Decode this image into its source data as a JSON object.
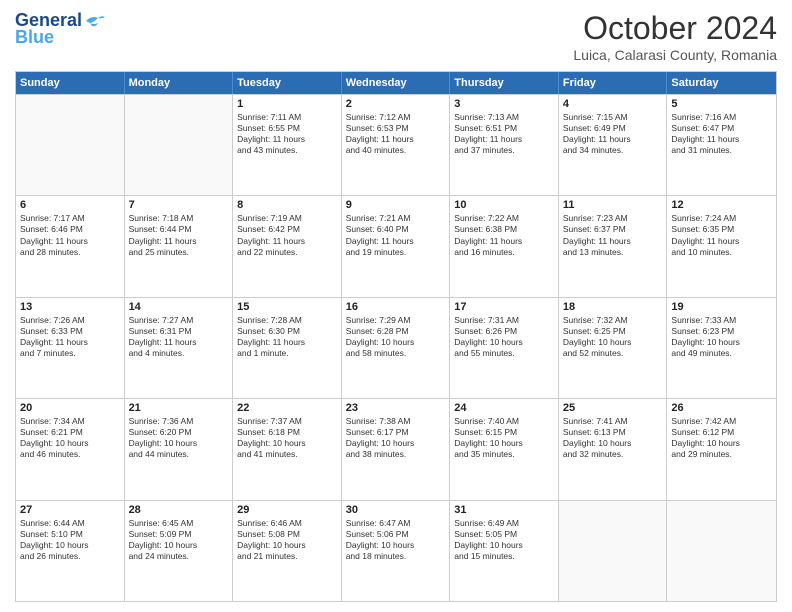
{
  "header": {
    "logo_general": "General",
    "logo_blue": "Blue",
    "month_title": "October 2024",
    "subtitle": "Luica, Calarasi County, Romania"
  },
  "calendar": {
    "days_of_week": [
      "Sunday",
      "Monday",
      "Tuesday",
      "Wednesday",
      "Thursday",
      "Friday",
      "Saturday"
    ],
    "weeks": [
      [
        {
          "day": "",
          "lines": []
        },
        {
          "day": "",
          "lines": []
        },
        {
          "day": "1",
          "lines": [
            "Sunrise: 7:11 AM",
            "Sunset: 6:55 PM",
            "Daylight: 11 hours",
            "and 43 minutes."
          ]
        },
        {
          "day": "2",
          "lines": [
            "Sunrise: 7:12 AM",
            "Sunset: 6:53 PM",
            "Daylight: 11 hours",
            "and 40 minutes."
          ]
        },
        {
          "day": "3",
          "lines": [
            "Sunrise: 7:13 AM",
            "Sunset: 6:51 PM",
            "Daylight: 11 hours",
            "and 37 minutes."
          ]
        },
        {
          "day": "4",
          "lines": [
            "Sunrise: 7:15 AM",
            "Sunset: 6:49 PM",
            "Daylight: 11 hours",
            "and 34 minutes."
          ]
        },
        {
          "day": "5",
          "lines": [
            "Sunrise: 7:16 AM",
            "Sunset: 6:47 PM",
            "Daylight: 11 hours",
            "and 31 minutes."
          ]
        }
      ],
      [
        {
          "day": "6",
          "lines": [
            "Sunrise: 7:17 AM",
            "Sunset: 6:46 PM",
            "Daylight: 11 hours",
            "and 28 minutes."
          ]
        },
        {
          "day": "7",
          "lines": [
            "Sunrise: 7:18 AM",
            "Sunset: 6:44 PM",
            "Daylight: 11 hours",
            "and 25 minutes."
          ]
        },
        {
          "day": "8",
          "lines": [
            "Sunrise: 7:19 AM",
            "Sunset: 6:42 PM",
            "Daylight: 11 hours",
            "and 22 minutes."
          ]
        },
        {
          "day": "9",
          "lines": [
            "Sunrise: 7:21 AM",
            "Sunset: 6:40 PM",
            "Daylight: 11 hours",
            "and 19 minutes."
          ]
        },
        {
          "day": "10",
          "lines": [
            "Sunrise: 7:22 AM",
            "Sunset: 6:38 PM",
            "Daylight: 11 hours",
            "and 16 minutes."
          ]
        },
        {
          "day": "11",
          "lines": [
            "Sunrise: 7:23 AM",
            "Sunset: 6:37 PM",
            "Daylight: 11 hours",
            "and 13 minutes."
          ]
        },
        {
          "day": "12",
          "lines": [
            "Sunrise: 7:24 AM",
            "Sunset: 6:35 PM",
            "Daylight: 11 hours",
            "and 10 minutes."
          ]
        }
      ],
      [
        {
          "day": "13",
          "lines": [
            "Sunrise: 7:26 AM",
            "Sunset: 6:33 PM",
            "Daylight: 11 hours",
            "and 7 minutes."
          ]
        },
        {
          "day": "14",
          "lines": [
            "Sunrise: 7:27 AM",
            "Sunset: 6:31 PM",
            "Daylight: 11 hours",
            "and 4 minutes."
          ]
        },
        {
          "day": "15",
          "lines": [
            "Sunrise: 7:28 AM",
            "Sunset: 6:30 PM",
            "Daylight: 11 hours",
            "and 1 minute."
          ]
        },
        {
          "day": "16",
          "lines": [
            "Sunrise: 7:29 AM",
            "Sunset: 6:28 PM",
            "Daylight: 10 hours",
            "and 58 minutes."
          ]
        },
        {
          "day": "17",
          "lines": [
            "Sunrise: 7:31 AM",
            "Sunset: 6:26 PM",
            "Daylight: 10 hours",
            "and 55 minutes."
          ]
        },
        {
          "day": "18",
          "lines": [
            "Sunrise: 7:32 AM",
            "Sunset: 6:25 PM",
            "Daylight: 10 hours",
            "and 52 minutes."
          ]
        },
        {
          "day": "19",
          "lines": [
            "Sunrise: 7:33 AM",
            "Sunset: 6:23 PM",
            "Daylight: 10 hours",
            "and 49 minutes."
          ]
        }
      ],
      [
        {
          "day": "20",
          "lines": [
            "Sunrise: 7:34 AM",
            "Sunset: 6:21 PM",
            "Daylight: 10 hours",
            "and 46 minutes."
          ]
        },
        {
          "day": "21",
          "lines": [
            "Sunrise: 7:36 AM",
            "Sunset: 6:20 PM",
            "Daylight: 10 hours",
            "and 44 minutes."
          ]
        },
        {
          "day": "22",
          "lines": [
            "Sunrise: 7:37 AM",
            "Sunset: 6:18 PM",
            "Daylight: 10 hours",
            "and 41 minutes."
          ]
        },
        {
          "day": "23",
          "lines": [
            "Sunrise: 7:38 AM",
            "Sunset: 6:17 PM",
            "Daylight: 10 hours",
            "and 38 minutes."
          ]
        },
        {
          "day": "24",
          "lines": [
            "Sunrise: 7:40 AM",
            "Sunset: 6:15 PM",
            "Daylight: 10 hours",
            "and 35 minutes."
          ]
        },
        {
          "day": "25",
          "lines": [
            "Sunrise: 7:41 AM",
            "Sunset: 6:13 PM",
            "Daylight: 10 hours",
            "and 32 minutes."
          ]
        },
        {
          "day": "26",
          "lines": [
            "Sunrise: 7:42 AM",
            "Sunset: 6:12 PM",
            "Daylight: 10 hours",
            "and 29 minutes."
          ]
        }
      ],
      [
        {
          "day": "27",
          "lines": [
            "Sunrise: 6:44 AM",
            "Sunset: 5:10 PM",
            "Daylight: 10 hours",
            "and 26 minutes."
          ]
        },
        {
          "day": "28",
          "lines": [
            "Sunrise: 6:45 AM",
            "Sunset: 5:09 PM",
            "Daylight: 10 hours",
            "and 24 minutes."
          ]
        },
        {
          "day": "29",
          "lines": [
            "Sunrise: 6:46 AM",
            "Sunset: 5:08 PM",
            "Daylight: 10 hours",
            "and 21 minutes."
          ]
        },
        {
          "day": "30",
          "lines": [
            "Sunrise: 6:47 AM",
            "Sunset: 5:06 PM",
            "Daylight: 10 hours",
            "and 18 minutes."
          ]
        },
        {
          "day": "31",
          "lines": [
            "Sunrise: 6:49 AM",
            "Sunset: 5:05 PM",
            "Daylight: 10 hours",
            "and 15 minutes."
          ]
        },
        {
          "day": "",
          "lines": []
        },
        {
          "day": "",
          "lines": []
        }
      ]
    ]
  }
}
